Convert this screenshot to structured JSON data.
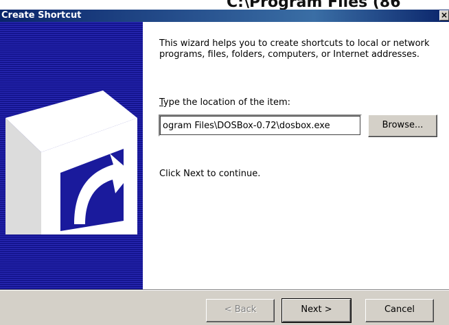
{
  "background": {
    "partial_title": "C:\\Program Files (86"
  },
  "window": {
    "title": "Create Shortcut",
    "close_glyph": "×",
    "accent_color": "#0a246a"
  },
  "wizard": {
    "intro_text": "This wizard helps you to create shortcuts to local or network programs, files, folders, computers, or Internet addresses.",
    "location_label_accel": "T",
    "location_label_rest": "ype the location of the item:",
    "location_value": "ogram Files\\DOSBox-0.72\\dosbox.exe",
    "browse_label": "Browse...",
    "continue_text": "Click Next to continue."
  },
  "buttons": {
    "back_label": "< Back",
    "next_label": "Next >",
    "cancel_label": "Cancel"
  }
}
